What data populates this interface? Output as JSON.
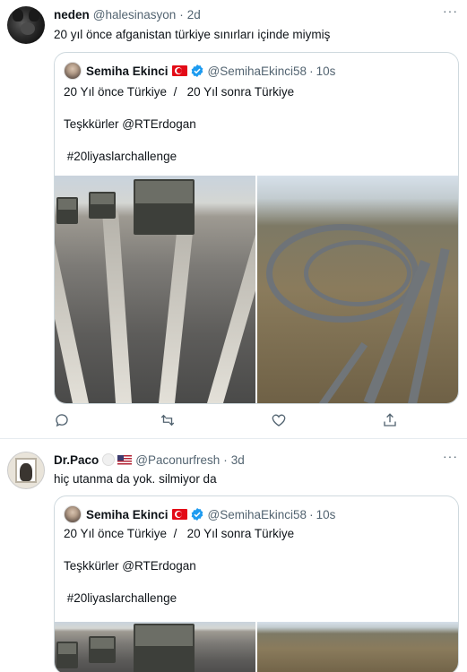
{
  "tweets": [
    {
      "author_name": "neden",
      "author_handle": "@halesinasyon",
      "dot": "·",
      "time": "2d",
      "text": "20 yıl önce afganistan türkiye sınırları içinde miymiş",
      "more": "···",
      "quote": {
        "author_name": "Semiha Ekinci",
        "author_handle": "@SemihaEkinci58",
        "dot": "·",
        "time": "10s",
        "line1": "20 Yıl önce Türkiye  /   20 Yıl sonra Türkiye",
        "line2": "Teşkkürler @RTErdogan",
        "line3": " #20liyaslarchallenge"
      }
    },
    {
      "author_name": "Dr.Paco",
      "author_handle": "@Paconurfresh",
      "dot": "·",
      "time": "3d",
      "text": "hiç utanma da yok. silmiyor da",
      "more": "···",
      "quote": {
        "author_name": "Semiha Ekinci",
        "author_handle": "@SemihaEkinci58",
        "dot": "·",
        "time": "10s",
        "line1": "20 Yıl önce Türkiye  /   20 Yıl sonra Türkiye",
        "line2": "Teşkkürler @RTErdogan",
        "line3": " #20liyaslarchallenge"
      }
    }
  ],
  "colors": {
    "text": "#0f1419",
    "secondary": "#536471",
    "border": "#cfd9de",
    "verified": "#1d9bf0"
  },
  "icons": [
    "reply-icon",
    "retweet-icon",
    "like-icon",
    "share-icon",
    "verified-icon",
    "more-icon"
  ]
}
